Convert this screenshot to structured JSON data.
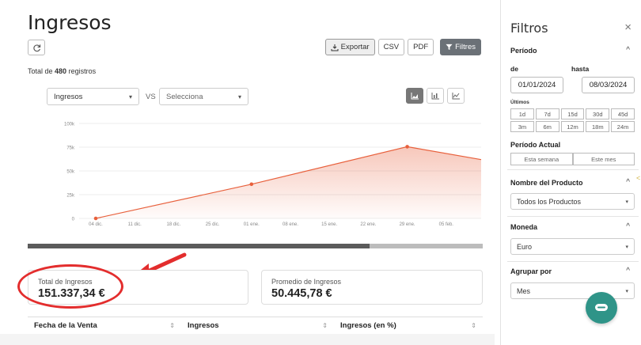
{
  "main": {
    "title": "Ingresos",
    "toolbar": {
      "export_label": "Exportar",
      "csv_label": "CSV",
      "pdf_label": "PDF",
      "filters_label": "Filtres"
    },
    "total_prefix": "Total de",
    "total_count": "480",
    "total_suffix": "registros",
    "metric_select": "Ingresos",
    "vs_label": "VS",
    "compare_select": "Selecciona"
  },
  "chart_data": {
    "type": "area",
    "x_ticks": [
      "04 dic.",
      "11 dic.",
      "18 dic.",
      "25 dic.",
      "01 ene.",
      "08 ene.",
      "15 ene.",
      "22 ene.",
      "29 ene.",
      "05 feb."
    ],
    "y_ticks": [
      "0",
      "25k",
      "50k",
      "75k",
      "100k"
    ],
    "ylim": [
      0,
      100000
    ],
    "points": [
      {
        "x": "04 dic.",
        "y": 0
      },
      {
        "x": "01 ene.",
        "y": 36000
      },
      {
        "x": "29 ene.",
        "y": 75500
      }
    ],
    "line_color": "#e8603c",
    "grid": true
  },
  "cards": {
    "total_label": "Total de Ingresos",
    "total_value": "151.337,34 €",
    "avg_label": "Promedio de Ingresos",
    "avg_value": "50.445,78 €"
  },
  "table": {
    "columns": [
      "Fecha de la Venta",
      "Ingresos",
      "Ingresos (en %)"
    ]
  },
  "filters": {
    "title": "Filtros",
    "close": "×",
    "period": {
      "heading": "Período",
      "from_label": "de",
      "to_label": "hasta",
      "from_value": "01/01/2024",
      "to_value": "08/03/2024",
      "last_label": "Últimos",
      "quick": [
        "1d",
        "7d",
        "15d",
        "30d",
        "45d",
        "3m",
        "6m",
        "12m",
        "18m",
        "24m"
      ],
      "current_heading": "Período Actual",
      "current_buttons": [
        "Esta semana",
        "Este mes"
      ]
    },
    "product": {
      "heading": "Nombre del Producto",
      "value": "Todos los Productos"
    },
    "currency": {
      "heading": "Moneda",
      "value": "Euro"
    },
    "group": {
      "heading": "Agrupar por",
      "value": "Mes"
    }
  }
}
